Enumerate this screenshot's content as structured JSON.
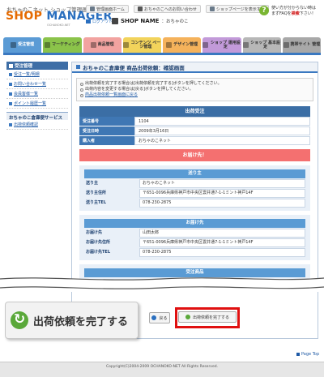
{
  "brand": {
    "sub": "おちゃのこネット ショップ管理画面",
    "name_shop": "SHOP",
    "name_manager": "MANAGER",
    "small": "OCHANOKO-NET"
  },
  "toplinks": [
    "管理画面ホーム",
    "おちゃのこへのお問い合わせ",
    "ショップページを表示する"
  ],
  "logout": "ログアウト",
  "shop": {
    "label": "SHOP NAME",
    "value": "：おちゃのこ"
  },
  "help": {
    "q": "?",
    "line1": "使い方が分からない時は",
    "line2_prefix": "まずFAQを",
    "line2_link": "検索",
    "line2_suffix": "下さい！"
  },
  "nav": [
    {
      "label": "受注管理"
    },
    {
      "label": "マーケティング"
    },
    {
      "label": "商品管理"
    },
    {
      "label": "コンテンツ ページ管理"
    },
    {
      "label": "デザイン管理"
    },
    {
      "label": "ショップ 運用設定"
    },
    {
      "label": "ショップ 基本設定"
    },
    {
      "label": "携帯サイト 管理"
    }
  ],
  "sidebar": {
    "head": "受注管理",
    "items": [
      "受注一覧/明細",
      "お問い合わせ一覧",
      "会員客様一覧",
      "ポイント履歴一覧"
    ],
    "head2": "おちゃのこ倉庫便サービス",
    "items2": [
      "出荷依頼確認"
    ]
  },
  "main": {
    "title": "おちゃのこ倉庫便 商品出荷依頼：確認画面",
    "notice1": "出荷依頼を完了する場合は[出荷依頼を完了する]ボタンを押してください。",
    "notice2": "出荷内容を変更する場合は[戻る]ボタンを押してください。",
    "notice_link": "商品出荷依頼一覧画面に戻る",
    "panel_title": "出荷受注",
    "order": [
      {
        "k": "受注番号",
        "v": "1104"
      },
      {
        "k": "受注日時",
        "v": "2009年3月16日"
      },
      {
        "k": "購入者",
        "v": "おちゃのこネット"
      }
    ],
    "alert": "お届け先！",
    "sender": {
      "title": "送り主",
      "rows": [
        {
          "k": "送り主",
          "v": "おちゃのこネット"
        },
        {
          "k": "送り主住所",
          "v": "〒651-0096兵庫県神戸市中央区雲井通7-1-1ミント神戸14F"
        },
        {
          "k": "送り主TEL",
          "v": "078-230-2875"
        }
      ]
    },
    "recipient": {
      "title": "お届け先",
      "rows": [
        {
          "k": "お届け先",
          "v": "山田太郎"
        },
        {
          "k": "お届け先住所",
          "v": "〒651-0096兵庫県神戸市中央区雲井通7-1-1ミント神戸14F"
        },
        {
          "k": "お届け先TEL",
          "v": "078-230-2875"
        }
      ]
    },
    "products_title": "受注商品"
  },
  "callout_label": "出荷依頼を完了する",
  "buttons": {
    "back": "戻る",
    "complete": "出荷依頼を完了する"
  },
  "pagetop": "Page Top",
  "footer": "Copyright(C)2004-2009 OCHANOKO-NET All Rights Reserved."
}
